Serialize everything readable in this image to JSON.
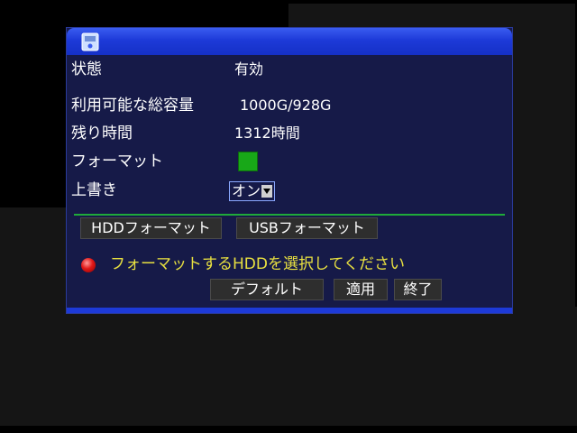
{
  "status": {
    "label": "状態",
    "value": "有効"
  },
  "capacity": {
    "label": "利用可能な総容量",
    "value": "1000G/928G"
  },
  "remaining": {
    "label": "残り時間",
    "value": "1312時間"
  },
  "format": {
    "label": "フォーマット",
    "checked": true
  },
  "overwrite": {
    "label": "上書き",
    "selected": "オン"
  },
  "buttons": {
    "hdd_format": "HDDフォーマット",
    "usb_format": "USBフォーマット",
    "default": "デフォルト",
    "apply": "適用",
    "exit": "終了"
  },
  "message": "フォーマットするHDDを選択してください",
  "colors": {
    "title_bar": "#1d3ad8",
    "panel_bg": "#161a48",
    "check_green": "#18a818",
    "message_yellow": "#e8e040",
    "alert_red": "#e01818",
    "divider_green": "#1faa3a"
  },
  "icons": {
    "title": "hdd-icon",
    "alert": "red-dot-icon",
    "dropdown": "chevron-down-icon"
  }
}
